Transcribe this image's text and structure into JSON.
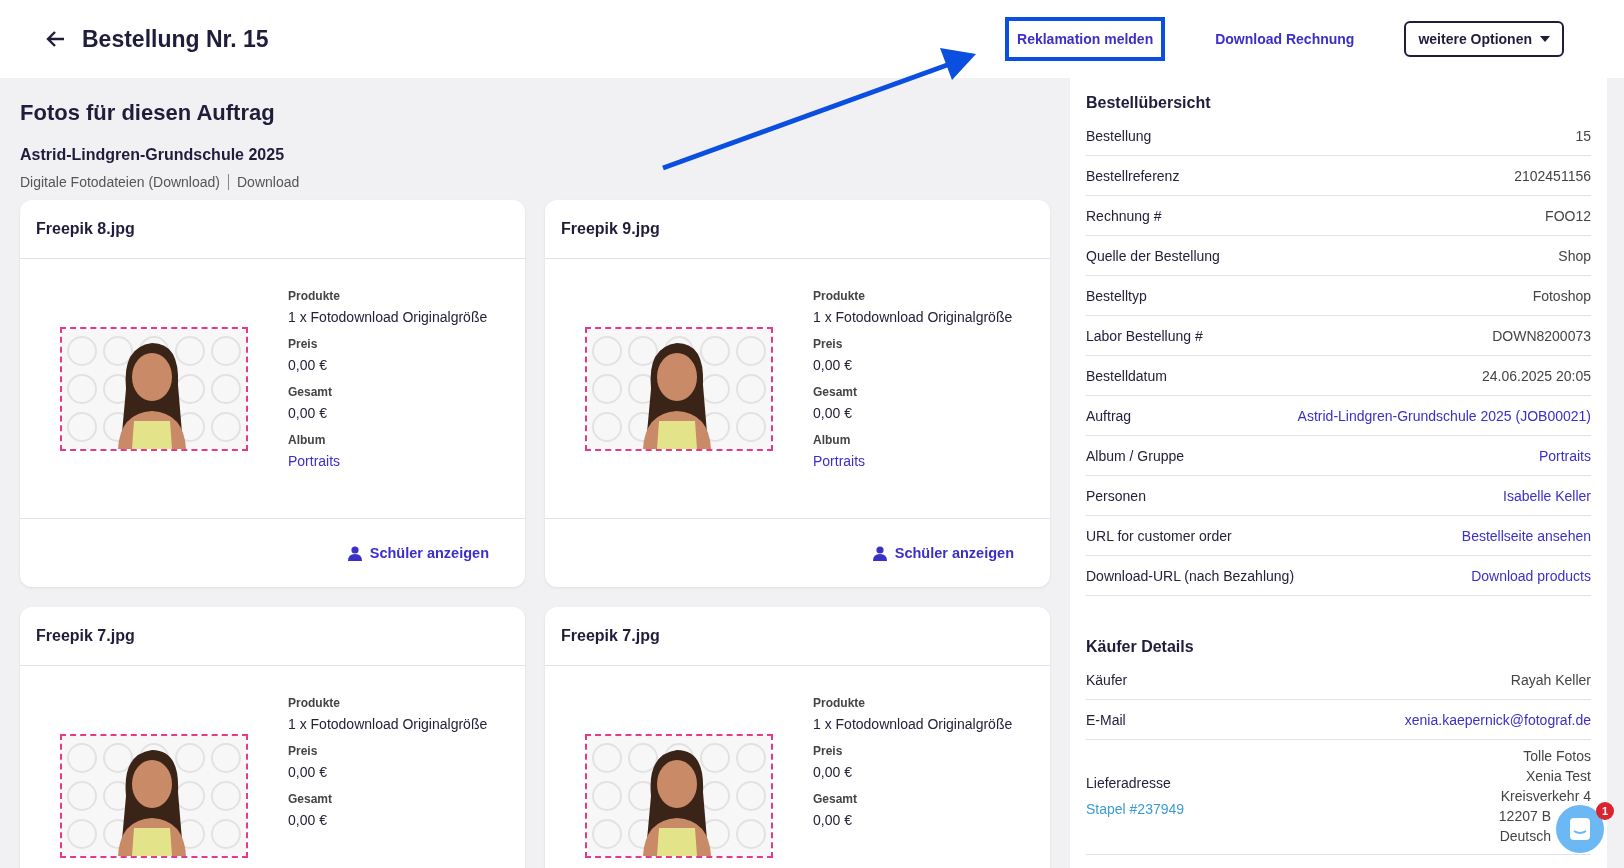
{
  "header": {
    "title": "Bestellung Nr. 15",
    "actions": [
      {
        "label": "Reklamation melden",
        "kind": "link",
        "highlighted": true
      },
      {
        "label": "Download Rechnung",
        "kind": "link",
        "highlighted": false
      },
      {
        "label": "weitere Optionen",
        "kind": "dropdown",
        "highlighted": false
      }
    ]
  },
  "photos_section": {
    "title": "Fotos für diesen Auftrag",
    "job": "Astrid-Lindgren-Grundschule 2025",
    "meta": [
      "Digitale Fotodateien (Download)",
      "Download"
    ]
  },
  "photos": [
    {
      "file": "Freepik 8.jpg",
      "fields": [
        {
          "label": "Produkte",
          "value": "1 x Fotodownload Originalgröße",
          "kind": "text"
        },
        {
          "label": "Preis",
          "value": "0,00 €",
          "kind": "text"
        },
        {
          "label": "Gesamt",
          "value": "0,00 €",
          "kind": "text"
        },
        {
          "label": "Album",
          "value": "Portraits",
          "kind": "link"
        }
      ],
      "action": "Schüler anzeigen"
    },
    {
      "file": "Freepik 9.jpg",
      "fields": [
        {
          "label": "Produkte",
          "value": "1 x Fotodownload Originalgröße",
          "kind": "text"
        },
        {
          "label": "Preis",
          "value": "0,00 €",
          "kind": "text"
        },
        {
          "label": "Gesamt",
          "value": "0,00 €",
          "kind": "text"
        },
        {
          "label": "Album",
          "value": "Portraits",
          "kind": "link"
        }
      ],
      "action": "Schüler anzeigen"
    },
    {
      "file": "Freepik 7.jpg",
      "fields": [
        {
          "label": "Produkte",
          "value": "1 x Fotodownload Originalgröße",
          "kind": "text"
        },
        {
          "label": "Preis",
          "value": "0,00 €",
          "kind": "text"
        },
        {
          "label": "Gesamt",
          "value": "0,00 €",
          "kind": "text"
        }
      ]
    },
    {
      "file": "Freepik 7.jpg",
      "fields": [
        {
          "label": "Produkte",
          "value": "1 x Fotodownload Originalgröße",
          "kind": "text"
        },
        {
          "label": "Preis",
          "value": "0,00 €",
          "kind": "text"
        },
        {
          "label": "Gesamt",
          "value": "0,00 €",
          "kind": "text"
        }
      ]
    }
  ],
  "summary": {
    "title": "Bestellübersicht",
    "rows": [
      {
        "label": "Bestellung",
        "value": "15",
        "kind": "text"
      },
      {
        "label": "Bestellreferenz",
        "value": "2102451156",
        "kind": "text"
      },
      {
        "label": "Rechnung #",
        "value": "FOO12",
        "kind": "text"
      },
      {
        "label": "Quelle der Bestellung",
        "value": "Shop",
        "kind": "text"
      },
      {
        "label": "Bestelltyp",
        "value": "Fotoshop",
        "kind": "text"
      },
      {
        "label": "Labor Bestellung #",
        "value": "DOWN8200073",
        "kind": "text"
      },
      {
        "label": "Bestelldatum",
        "value": "24.06.2025 20:05",
        "kind": "text"
      },
      {
        "label": "Auftrag",
        "value": "Astrid-Lindgren-Grundschule 2025 (JOB00021)",
        "kind": "link"
      },
      {
        "label": "Album / Gruppe",
        "value": "Portraits",
        "kind": "link"
      },
      {
        "label": "Personen",
        "value": "Isabelle Keller",
        "kind": "link"
      },
      {
        "label": "URL for customer order",
        "value": "Bestellseite ansehen",
        "kind": "link"
      },
      {
        "label": "Download-URL (nach Bezahlung)",
        "value": "Download products",
        "kind": "link"
      }
    ]
  },
  "buyer": {
    "title": "Käufer Details",
    "rows": [
      {
        "label": "Käufer",
        "value": "Rayah Keller",
        "kind": "text"
      },
      {
        "label": "E-Mail",
        "value": "xenia.kaepernick@fotograf.de",
        "kind": "link"
      }
    ],
    "address": {
      "label": "Lieferadresse",
      "link": "Stapel #237949",
      "lines": [
        "Tolle Fotos",
        "Xenia Test",
        "Kreisverkehr 4",
        "12207 B",
        "Deutsch"
      ]
    }
  },
  "chat": {
    "badge": "1"
  }
}
